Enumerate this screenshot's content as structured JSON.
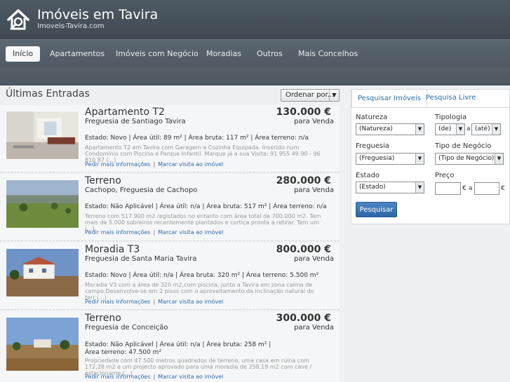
{
  "site": {
    "title": "Imóveis em Tavira",
    "subtitle": "Imoveis-Tavira.com",
    "logo_icon": "house-search-icon"
  },
  "nav": {
    "items": [
      {
        "label": "Início",
        "active": true
      },
      {
        "label": "Apartamentos"
      },
      {
        "label": "Imóveis com Negócio"
      },
      {
        "label": "Moradias"
      },
      {
        "label": "Outros"
      },
      {
        "label": "Mais Concelhos"
      }
    ]
  },
  "main": {
    "title": "Últimas Entradas",
    "sort_label": "Ordenar por...",
    "listings": [
      {
        "title": "Apartamento  T2",
        "location": "Freguesia de Santiago Tavira",
        "price": "130.000 €",
        "operation": "para Venda",
        "stats": "Estado: Novo  | Área útil: 89 m²  | Área bruta: 117 m²  | Área terreno: n/a",
        "description": "Apartamento T2 em Tavira com Garagem e Cozinha Equipada. Inserido num Condomínio com Piscina e Parque Infantil. Marque já a sua Visita: 91 955 49 90 - 96 810 87 (...)",
        "link_info": "Pedir mais informações",
        "link_visit": "Marcar visita ao imóvel"
      },
      {
        "title": "Terreno",
        "location": "Cachopo, Freguesia de Cachopo",
        "price": "280.000 €",
        "operation": "para Venda",
        "stats": "Estado: Não Aplicável  | Área útil: n/a  | Área bruta: 517 m²  | Área terreno: n/a",
        "description": "Terreno com 517.900 m2 registados no entanto com área total de 700.000 m2. Tem mais de 5.000 sobreiros recentemente plantados e cortiça pronta a retirar. Tem um (...)",
        "link_info": "Pedir mais informações",
        "link_visit": "Marcar visita ao imóvel"
      },
      {
        "title": "Moradia  T3",
        "location": "Freguesia de Santa Maria Tavira",
        "price": "800.000 €",
        "operation": "para Venda",
        "stats": "Estado: Novo  | Área útil: n/a  | Área bruta: 320 m²  | Área terreno: 5.500 m²",
        "description": "Moradia V3 com a área de 320 m2,com piscina, junto a Tavira em zona calma de campo.Desenvolve-se em 2 pisos com o aproveitamento da inclinação natural do terr (...)",
        "link_info": "Pedir mais informações",
        "link_visit": "Marcar visita ao imóvel"
      },
      {
        "title": "Terreno",
        "location": "Freguesia de Conceição",
        "price": "300.000 €",
        "operation": "para Venda",
        "stats": "Estado: Não Aplicável  | Área útil: n/a  | Área bruta: 258 m²  | Área terreno: 47.500 m²",
        "description": "Propriedade com 47.500 metros quadrados de terreno, uma casa em ruína com 172,28 m2 e um projecto aprovado para uma moradia de 258,19 m2 com cave / estacioname (...)",
        "link_info": "Pedir mais informações",
        "link_visit": "Marcar visita ao imóvel"
      }
    ]
  },
  "search": {
    "tabs": [
      "Pesquisar Imóveis",
      "Pesquisa Livre"
    ],
    "natureza_label": "Natureza",
    "natureza_value": "(Natureza)",
    "tipologia_label": "Tipologia",
    "tipologia_from": "(de)",
    "tipologia_sep": "a",
    "tipologia_to": "(até)",
    "freguesia_label": "Freguesia",
    "freguesia_value": "(Freguesia)",
    "negocio_label": "Tipo de Negócio",
    "negocio_value": "(Tipo de Negócio)",
    "estado_label": "Estado",
    "estado_value": "(Estado)",
    "preco_label": "Preço",
    "preco_unit": "€",
    "preco_sep": "a",
    "button": "Pesquisar"
  }
}
